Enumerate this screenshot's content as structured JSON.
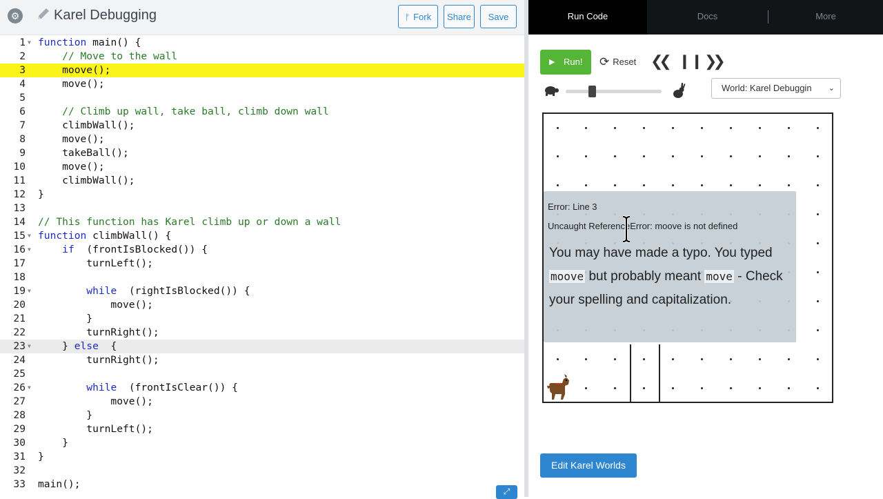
{
  "editor": {
    "title": "Karel Debugging",
    "fork_label": "Fork",
    "share_label": "Share",
    "save_label": "Save",
    "highlighted_line": 3,
    "cursor_line": 23,
    "lines": [
      {
        "n": "1",
        "fold": true,
        "parts": [
          [
            "kw",
            "function"
          ],
          [
            "",
            "main() {"
          ]
        ]
      },
      {
        "n": "2",
        "parts": [
          [
            "",
            "    "
          ],
          [
            "cm",
            "// Move to the wall"
          ]
        ]
      },
      {
        "n": "3",
        "parts": [
          [
            "",
            "    moove();"
          ]
        ]
      },
      {
        "n": "4",
        "parts": [
          [
            "",
            "    move();"
          ]
        ]
      },
      {
        "n": "5",
        "parts": []
      },
      {
        "n": "6",
        "parts": [
          [
            "",
            "    "
          ],
          [
            "cm",
            "// Climb up wall, take ball, climb down wall"
          ]
        ]
      },
      {
        "n": "7",
        "parts": [
          [
            "",
            "    climbWall();"
          ]
        ]
      },
      {
        "n": "8",
        "parts": [
          [
            "",
            "    move();"
          ]
        ]
      },
      {
        "n": "9",
        "parts": [
          [
            "",
            "    takeBall();"
          ]
        ]
      },
      {
        "n": "10",
        "parts": [
          [
            "",
            "    move();"
          ]
        ]
      },
      {
        "n": "11",
        "parts": [
          [
            "",
            "    climbWall();"
          ]
        ]
      },
      {
        "n": "12",
        "parts": [
          [
            "",
            "}"
          ]
        ]
      },
      {
        "n": "13",
        "parts": []
      },
      {
        "n": "14",
        "parts": [
          [
            "cm",
            "// This function has Karel climb up or down a wall"
          ]
        ]
      },
      {
        "n": "15",
        "fold": true,
        "parts": [
          [
            "kw",
            "function"
          ],
          [
            "",
            "climbWall() {"
          ]
        ]
      },
      {
        "n": "16",
        "fold": true,
        "parts": [
          [
            "",
            "    "
          ],
          [
            "kw",
            "if"
          ],
          [
            "",
            " (frontIsBlocked()) {"
          ]
        ]
      },
      {
        "n": "17",
        "parts": [
          [
            "",
            "        turnLeft();"
          ]
        ]
      },
      {
        "n": "18",
        "parts": []
      },
      {
        "n": "19",
        "fold": true,
        "parts": [
          [
            "",
            "        "
          ],
          [
            "kw",
            "while"
          ],
          [
            "",
            " (rightIsBlocked()) {"
          ]
        ]
      },
      {
        "n": "20",
        "parts": [
          [
            "",
            "            move();"
          ]
        ]
      },
      {
        "n": "21",
        "parts": [
          [
            "",
            "        }"
          ]
        ]
      },
      {
        "n": "22",
        "parts": [
          [
            "",
            "        turnRight();"
          ]
        ]
      },
      {
        "n": "23",
        "fold": true,
        "parts": [
          [
            "",
            "    } "
          ],
          [
            "kw",
            "else"
          ],
          [
            "",
            " {"
          ]
        ]
      },
      {
        "n": "24",
        "parts": [
          [
            "",
            "        turnRight();"
          ]
        ]
      },
      {
        "n": "25",
        "parts": []
      },
      {
        "n": "26",
        "fold": true,
        "parts": [
          [
            "",
            "        "
          ],
          [
            "kw",
            "while"
          ],
          [
            "",
            " (frontIsClear()) {"
          ]
        ]
      },
      {
        "n": "27",
        "parts": [
          [
            "",
            "            move();"
          ]
        ]
      },
      {
        "n": "28",
        "parts": [
          [
            "",
            "        }"
          ]
        ]
      },
      {
        "n": "29",
        "parts": [
          [
            "",
            "        turnLeft();"
          ]
        ]
      },
      {
        "n": "30",
        "parts": [
          [
            "",
            "    }"
          ]
        ]
      },
      {
        "n": "31",
        "parts": [
          [
            "",
            "}"
          ]
        ]
      },
      {
        "n": "32",
        "parts": []
      },
      {
        "n": "33",
        "parts": [
          [
            "",
            "main();"
          ]
        ]
      }
    ]
  },
  "run_panel": {
    "tabs": [
      "Run Code",
      "Docs",
      "More"
    ],
    "run_label": "Run!",
    "reset_label": "Reset",
    "speed_level": 0.28,
    "world_select": "World: Karel Debuggin",
    "error": {
      "title": "Error: Line 3",
      "detail": "Uncaught ReferenceError: moove is not defined",
      "msg_1": "You may have made a typo. You typed",
      "code_1": "moove",
      "msg_2": "but probably meant",
      "code_2": "move",
      "msg_3": "- Check your spelling and capitalization."
    },
    "edit_worlds_label": "Edit Karel Worlds"
  },
  "world": {
    "columns": 10,
    "rows": 10,
    "karel_position": {
      "col": 1,
      "row": 1
    }
  },
  "colors": {
    "highlight": "#fbf419",
    "accent_blue": "#2d86cf",
    "run_green": "#55b537",
    "tab_bar": "#111518"
  }
}
